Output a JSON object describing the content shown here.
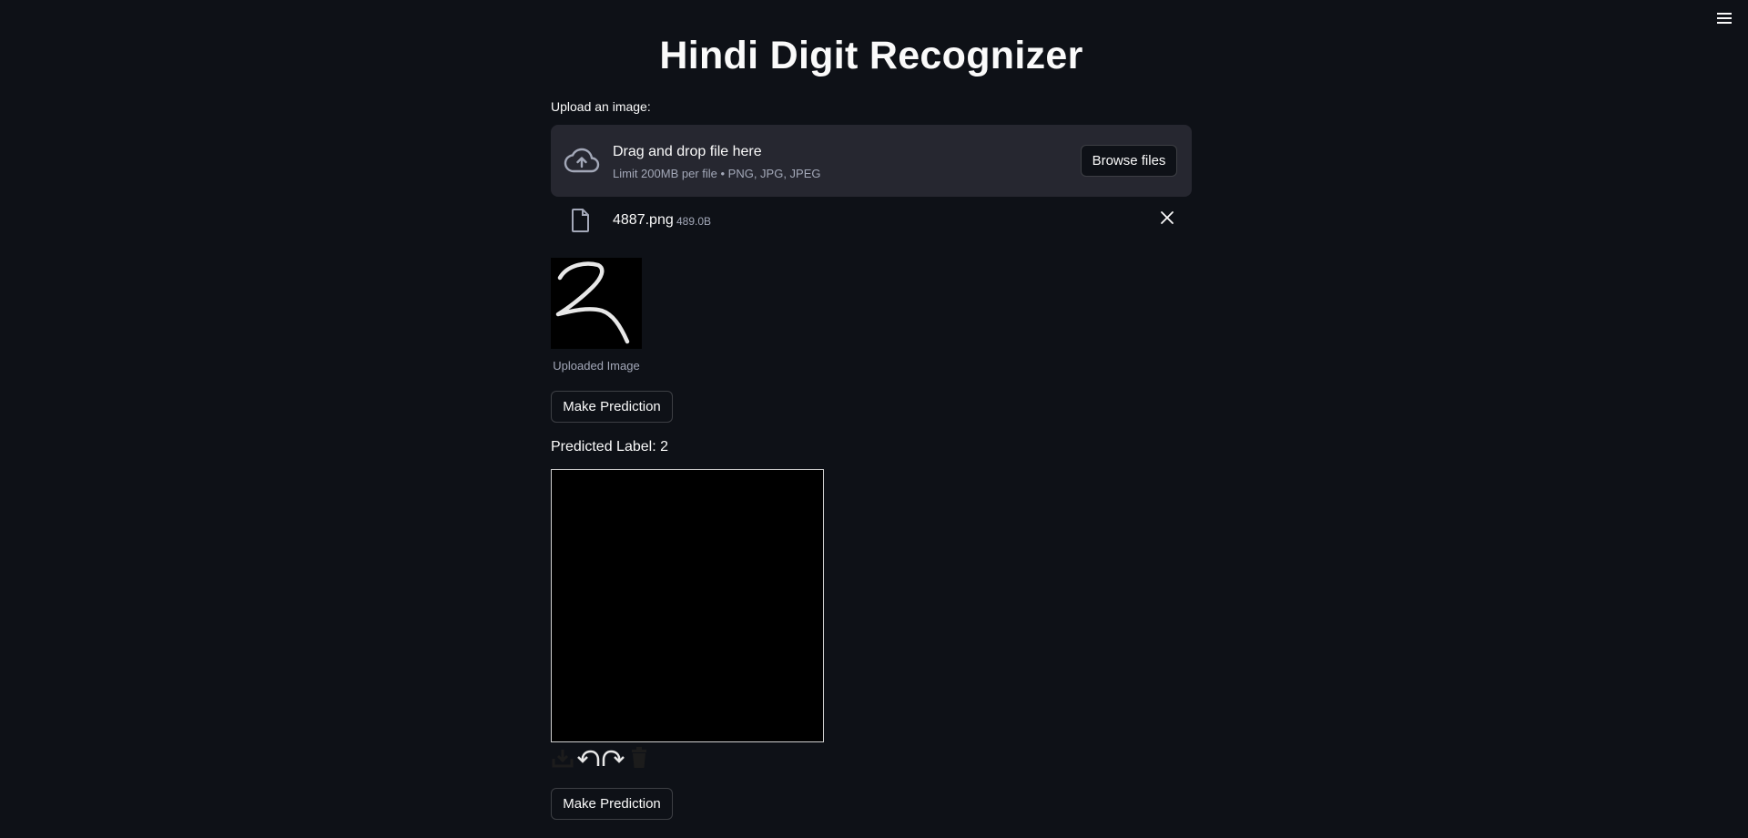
{
  "app": {
    "title": "Hindi Digit Recognizer"
  },
  "uploader": {
    "label": "Upload an image:",
    "drop_title": "Drag and drop file here",
    "drop_hint": "Limit 200MB per file • PNG, JPG, JPEG",
    "browse_label": "Browse files"
  },
  "file": {
    "name": "4887.png",
    "size": "489.0B"
  },
  "image": {
    "caption": "Uploaded Image"
  },
  "actions": {
    "predict_label": "Make Prediction",
    "predict_label_2": "Make Prediction"
  },
  "result": {
    "text": "Predicted Label: 2"
  },
  "canvas_toolbar": {
    "icons": [
      "download-icon",
      "undo-icon",
      "redo-icon",
      "trash-icon"
    ]
  },
  "colors": {
    "background": "#0e1117",
    "dropzone": "#262730",
    "text": "#fafafa",
    "muted": "#a3a8b8"
  }
}
